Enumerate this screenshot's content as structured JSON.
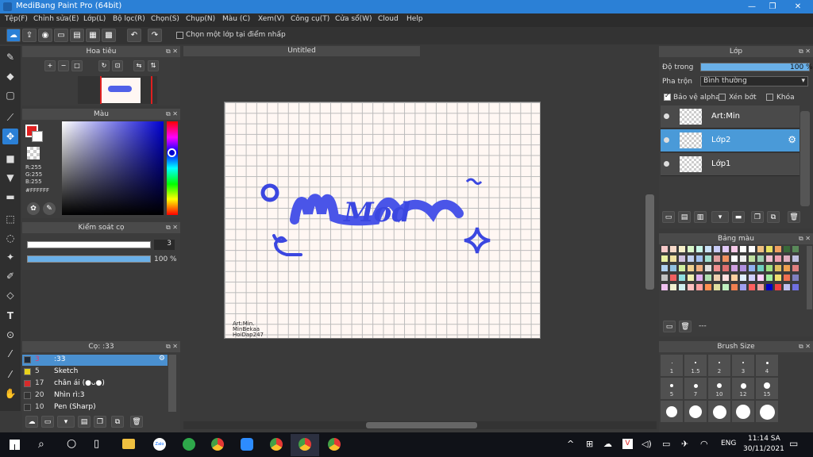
{
  "app": {
    "title": "MediBang Paint Pro (64bit)"
  },
  "window_controls": {
    "minimize": "—",
    "restore": "❐",
    "close": "✕"
  },
  "menu": [
    "Tệp(F)",
    "Chỉnh sửa(E)",
    "Lớp(L)",
    "Bộ lọc(R)",
    "Chọn(S)",
    "Chụp(N)",
    "Màu (C)",
    "Xem(V)",
    "Công cụ(T)",
    "Cửa sổ(W)",
    "Cloud",
    "Help"
  ],
  "toolbar": {
    "checkbox_label": "Chọn một lớp tại điểm nhấp",
    "undo": "↶",
    "redo": "↷"
  },
  "navigator": {
    "title": "Hoa tiêu"
  },
  "color_panel": {
    "title": "Màu",
    "r": "R:255",
    "g": "G:255",
    "b": "B:255",
    "hex": "#FFFFFF"
  },
  "brush_control": {
    "title": "Kiểm soát cọ",
    "size": "3",
    "opacity": "100 %",
    "opacity_fill": 1.0
  },
  "brush_list": {
    "title": "Cọ: :33",
    "items": [
      {
        "num": "3",
        "name": ":33",
        "color": "#1e2a3a",
        "selected": true
      },
      {
        "num": "5",
        "name": "Sketch",
        "color": "#e8d21c",
        "selected": false
      },
      {
        "num": "17",
        "name": "chân ái (●ᴗ●)",
        "color": "#d62b2b",
        "selected": false
      },
      {
        "num": "20",
        "name": "Nhìn rì:3",
        "color": "#333333",
        "selected": false
      },
      {
        "num": "10",
        "name": "Pen (Sharp)",
        "color": "#333333",
        "selected": false
      }
    ]
  },
  "canvas": {
    "tab": "Untitled",
    "art_text": "Mod",
    "credit_1": "Art:Min.",
    "credit_2": "MinBekaa",
    "credit_3": "HoiDap247"
  },
  "layer_panel": {
    "title": "Lớp",
    "opacity_label": "Độ trong",
    "opacity_value": "100 %",
    "opacity_fill": 1.0,
    "blend_label": "Pha trộn",
    "blend_value": "Bình thường",
    "protect_alpha": "Bảo vệ alpha",
    "clipping": "Xén bớt",
    "lock": "Khóa",
    "layers": [
      {
        "name": "Art:Min",
        "selected": false
      },
      {
        "name": "Lớp2",
        "selected": true
      },
      {
        "name": "Lớp1",
        "selected": false
      }
    ]
  },
  "palette": {
    "title": "Bảng màu",
    "dash": "---",
    "colors": [
      "#f7c9c9",
      "#f7d9c9",
      "#f7f0c9",
      "#d9f7c9",
      "#c9f7e8",
      "#c9e1f7",
      "#c9cdf7",
      "#e1c9f7",
      "#f7c9e8",
      "#ffffff",
      "#ffffff",
      "#f0c080",
      "#e8e060",
      "#f0a060",
      "#3a6a3a",
      "#5a8a5a",
      "#e8f0a0",
      "#f0e0a0",
      "#d0c0e0",
      "#c0d0f0",
      "#a0c0f0",
      "#a0e0d0",
      "#e0a0a0",
      "#f09060",
      "#ffffff",
      "#f0f0f0",
      "#c0e0a0",
      "#a0d0b0",
      "#f0c0d0",
      "#f0a0b0",
      "#e0b0c0",
      "#c0c0e0",
      "#b0d0f0",
      "#90c0e0",
      "#d0f0a0",
      "#f0d090",
      "#f0b080",
      "#e0e0e0",
      "#f09090",
      "#e07070",
      "#d0a0e0",
      "#b090e0",
      "#90b0f0",
      "#70d0c0",
      "#a0e080",
      "#e0c060",
      "#f0a050",
      "#e08080",
      "#c0c0c0",
      "#f06060",
      "#90e0e0",
      "#f0f0b0",
      "#e0b0f0",
      "#b0e0b0",
      "#f0d0b0",
      "#ffe0e0",
      "#ffd0a0",
      "#e0f0ff",
      "#d0d0ff",
      "#ffd0ff",
      "#a0f0a0",
      "#f0e070",
      "#f07050",
      "#8080c0",
      "#f0c0f0",
      "#f0f0d0",
      "#d0f0f0",
      "#ffc0c0",
      "#ffa0a0",
      "#ff9050",
      "#e0e0a0",
      "#c0f0c0",
      "#f08050",
      "#a0a0f0",
      "#ff6060",
      "#f0a0a0",
      "#0000c8",
      "#f04040",
      "#c0c0f0",
      "#7070e0"
    ]
  },
  "brush_size": {
    "title": "Brush Size",
    "labels": [
      "1",
      "1.5",
      "2",
      "3",
      "4",
      "5",
      "7",
      "10",
      "12",
      "15"
    ]
  },
  "taskbar": {
    "lang": "ENG",
    "time": "11:14 SA",
    "date": "30/11/2021"
  }
}
